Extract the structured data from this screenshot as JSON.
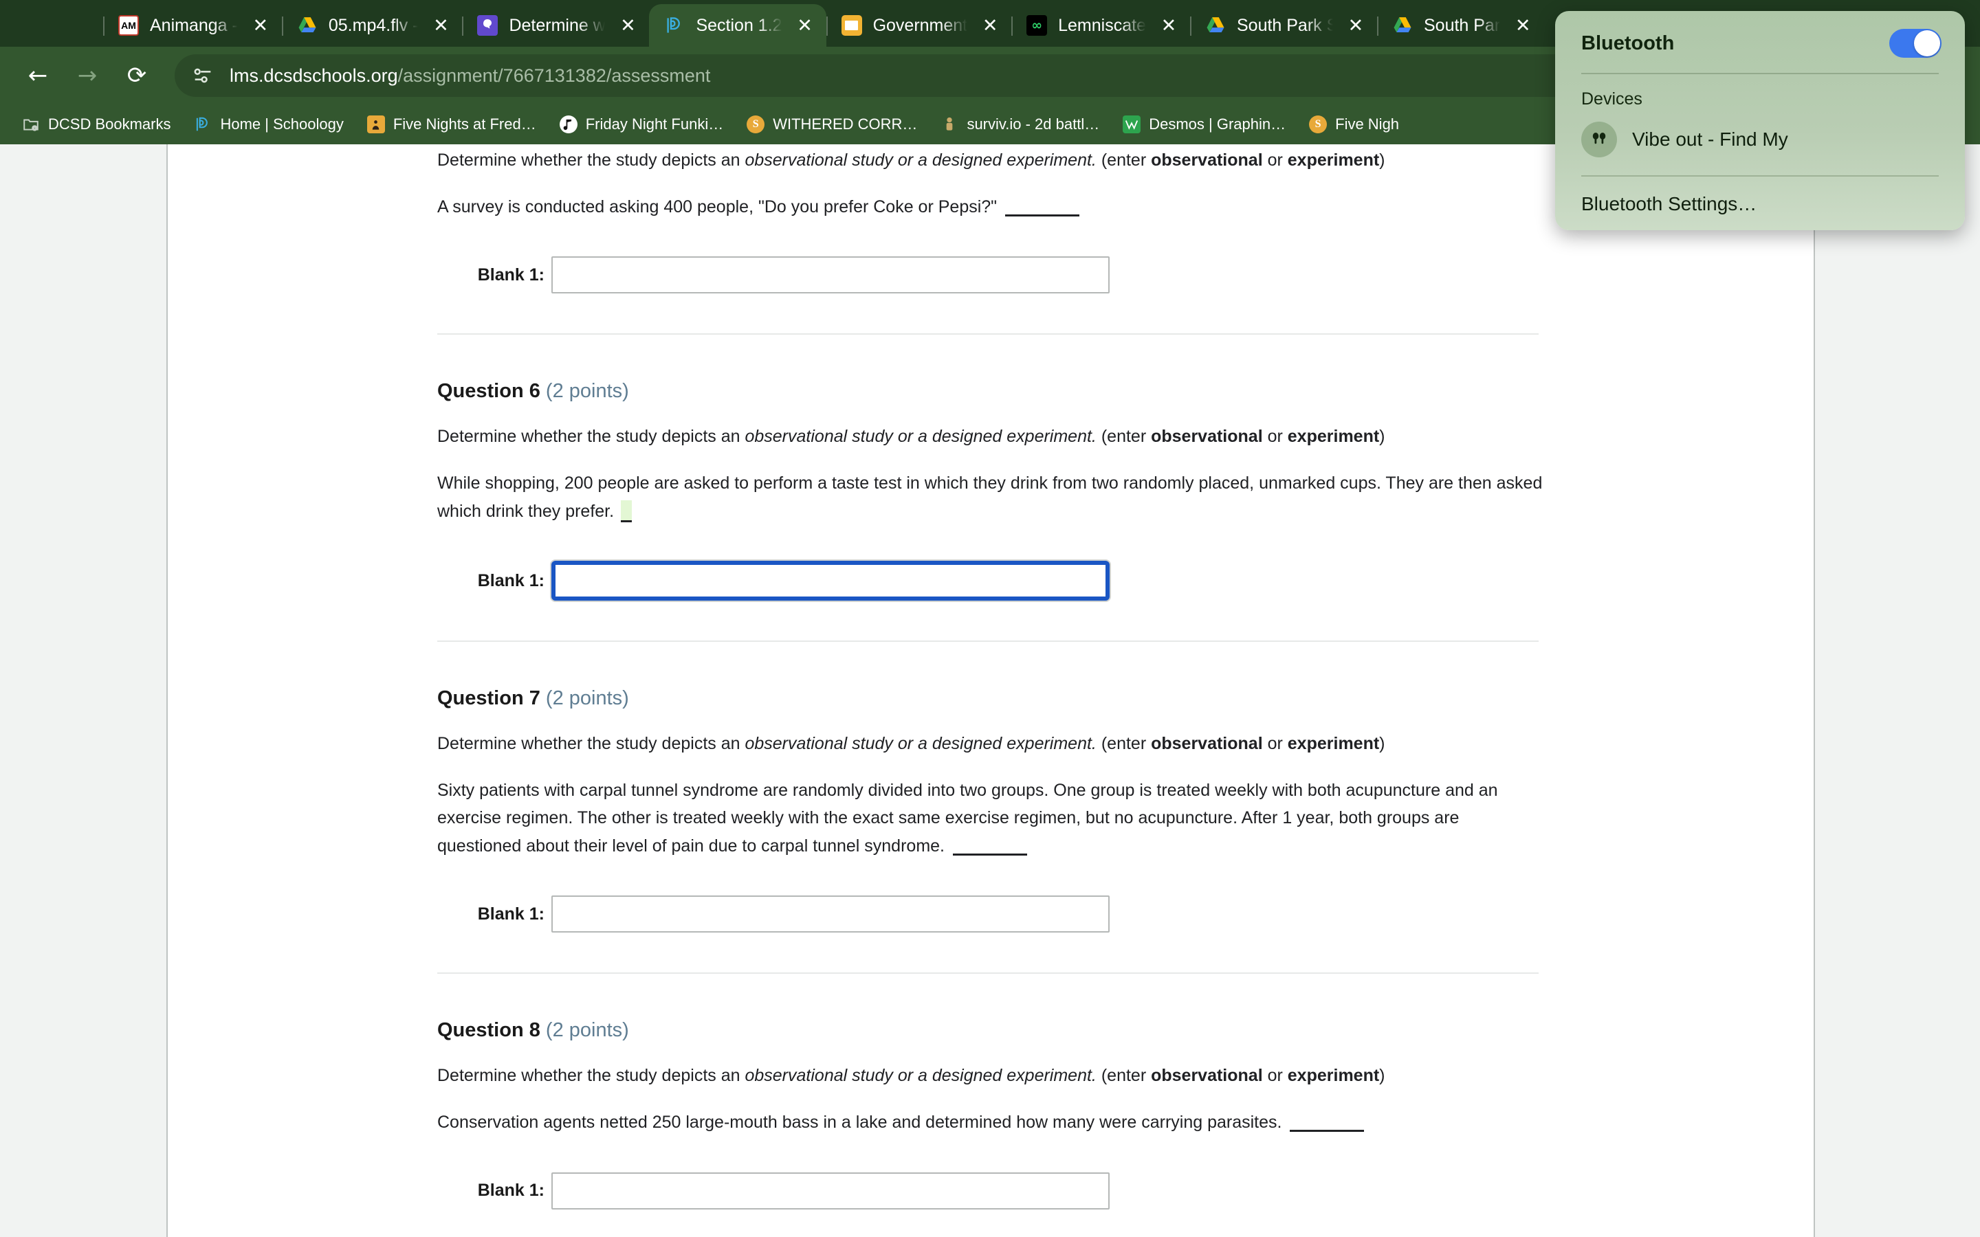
{
  "browser": {
    "tabs": [
      {
        "title": "Animanga -",
        "icon": "animanga-favicon",
        "active": false
      },
      {
        "title": "05.mp4.flv -",
        "icon": "google-drive-favicon",
        "active": false
      },
      {
        "title": "Determine w",
        "icon": "brainly-favicon",
        "active": false
      },
      {
        "title": "Section 1.2",
        "icon": "schoology-favicon",
        "active": true
      },
      {
        "title": "Government",
        "icon": "google-slides-favicon",
        "active": false
      },
      {
        "title": "Lemniscate",
        "icon": "lemniscate-favicon",
        "active": false
      },
      {
        "title": "South Park S",
        "icon": "google-drive-favicon",
        "active": false
      },
      {
        "title": "South Par",
        "icon": "google-drive-favicon",
        "active": false
      }
    ],
    "close_label": "✕",
    "nav": {
      "back": "←",
      "forward": "→",
      "reload": "⟳"
    },
    "omnibox": {
      "host": "lms.dcsdschools.org",
      "path": "/assignment/7667131382/assessment"
    },
    "bookmarks": [
      {
        "label": "DCSD Bookmarks",
        "icon": "folder-settings-icon"
      },
      {
        "label": "Home | Schoology",
        "icon": "schoology-favicon"
      },
      {
        "label": "Five Nights at Fred…",
        "icon": "fnaf-favicon"
      },
      {
        "label": "Friday Night Funki…",
        "icon": "fnf-favicon"
      },
      {
        "label": "WITHERED CORR…",
        "icon": "scratch-favicon"
      },
      {
        "label": "surviv.io - 2d battl…",
        "icon": "surviv-favicon"
      },
      {
        "label": "Desmos | Graphin…",
        "icon": "desmos-favicon"
      },
      {
        "label": "Five Nigh",
        "icon": "scratch-favicon"
      }
    ]
  },
  "bluetooth": {
    "title": "Bluetooth",
    "toggle_on": true,
    "toggle_color": "#3b78ee",
    "devices_label": "Devices",
    "device_name": "Vibe out - Find My",
    "settings_label": "Bluetooth Settings…"
  },
  "assessment": {
    "shared_prompt": {
      "lead": "Determine whether the study depicts an ",
      "italic": "observational study or a designed experiment.",
      "tail_open": "  (enter ",
      "bold1": "observational",
      "mid": " or ",
      "bold2": "experiment",
      "tail_close": ")"
    },
    "blank_label": "Blank 1:",
    "questions": [
      {
        "number": "",
        "points": "",
        "stem": "A survey is conducted asking 400 people, \"Do you prefer Coke or Pepsi?\"",
        "blank_style": "line",
        "focused": false,
        "partial": true
      },
      {
        "number": "Question 6",
        "points": "(2 points)",
        "stem": "While shopping, 200 people are asked to perform a taste test in which they drink from two randomly placed, unmarked cups. They are then asked which drink they prefer.",
        "blank_style": "highlight",
        "focused": true,
        "partial": false
      },
      {
        "number": "Question 7",
        "points": "(2 points)",
        "stem": "Sixty patients with carpal tunnel syndrome are randomly divided into two groups. One group is treated weekly with both acupuncture and an exercise regimen. The other is treated weekly with the exact same exercise regimen, but no acupuncture. After 1 year, both groups are questioned about their level of pain due to carpal tunnel syndrome.",
        "blank_style": "line",
        "focused": false,
        "partial": false
      },
      {
        "number": "Question 8",
        "points": "(2 points)",
        "stem": "Conservation agents netted 250 large-mouth bass in a lake and determined how many were carrying parasites.",
        "blank_style": "line",
        "focused": false,
        "partial": false
      }
    ]
  }
}
